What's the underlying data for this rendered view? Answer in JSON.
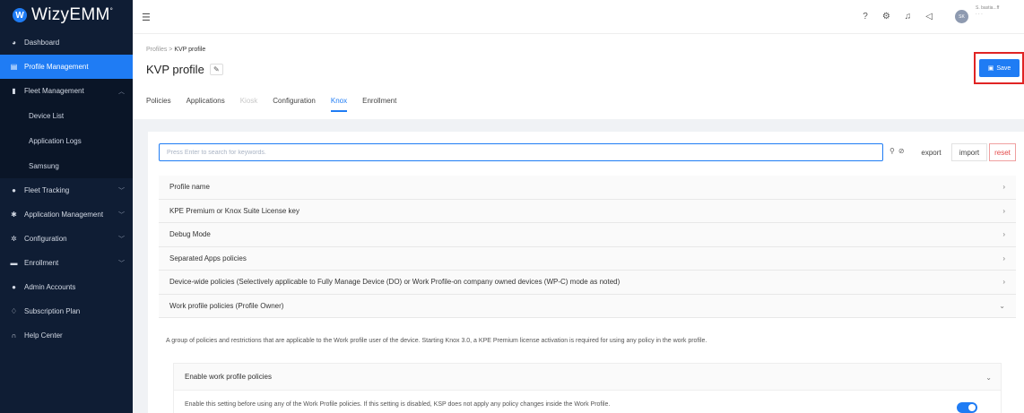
{
  "app": {
    "logo_letter": "W",
    "name": "WizyEMM",
    "mark": "°"
  },
  "sidebar": {
    "items": [
      {
        "label": "Dashboard",
        "icon": "gauge-icon"
      },
      {
        "label": "Profile Management",
        "icon": "file-icon",
        "active": true
      },
      {
        "label": "Fleet Management",
        "icon": "phone-icon",
        "expanded": true
      },
      {
        "label": "Fleet Tracking",
        "icon": "pin-icon"
      },
      {
        "label": "Application Management",
        "icon": "apps-icon"
      },
      {
        "label": "Configuration",
        "icon": "gear-icon"
      },
      {
        "label": "Enrollment",
        "icon": "card-icon"
      },
      {
        "label": "Admin Accounts",
        "icon": "user-icon"
      },
      {
        "label": "Subscription Plan",
        "icon": "diamond-icon"
      },
      {
        "label": "Help Center",
        "icon": "headset-icon"
      }
    ],
    "fleet_sub": [
      "Device List",
      "Application Logs",
      "Samsung"
    ]
  },
  "topbar": {
    "avatar_initials": "SK",
    "user_name_line1": "S. bastia...ff",
    "user_name_line2": "· · ·"
  },
  "header": {
    "breadcrumb_root": "Profiles",
    "breadcrumb_sep": ">",
    "breadcrumb_current": "KVP profile",
    "title": "KVP profile",
    "save_label": "Save"
  },
  "tabs": [
    {
      "label": "Policies"
    },
    {
      "label": "Applications"
    },
    {
      "label": "Kiosk",
      "disabled": true
    },
    {
      "label": "Configuration"
    },
    {
      "label": "Knox",
      "active": true
    },
    {
      "label": "Enrollment"
    }
  ],
  "search": {
    "placeholder": "Press Enter to search for keywords.",
    "value": ""
  },
  "actions": {
    "export": "export",
    "import": "import",
    "reset": "reset"
  },
  "sections": [
    {
      "label": "Profile name"
    },
    {
      "label": "KPE Premium or Knox Suite License key"
    },
    {
      "label": "Debug Mode"
    },
    {
      "label": "Separated Apps policies"
    },
    {
      "label": "Device-wide policies (Selectively applicable to Fully Manage Device (DO) or Work Profile-on company owned devices (WP-C) mode as noted)"
    },
    {
      "label": "Work profile policies (Profile Owner)",
      "open": true
    }
  ],
  "work_profile": {
    "description": "A group of policies and restrictions that are applicable to the Work profile user of the device. Starting Knox 3.0, a KPE Premium license activation is required for using any policy in the work profile.",
    "sub_section": "Enable work profile policies",
    "sub_description": "Enable this setting before using any of the Work Profile policies. If this setting is disabled, KSP does not apply any policy changes inside the Work Profile.",
    "enabled": true
  },
  "colors": {
    "accent": "#1f7cf4",
    "sidebar_bg": "#0f1d34",
    "highlight_border": "#e02424",
    "reset": "#e34a4a"
  }
}
